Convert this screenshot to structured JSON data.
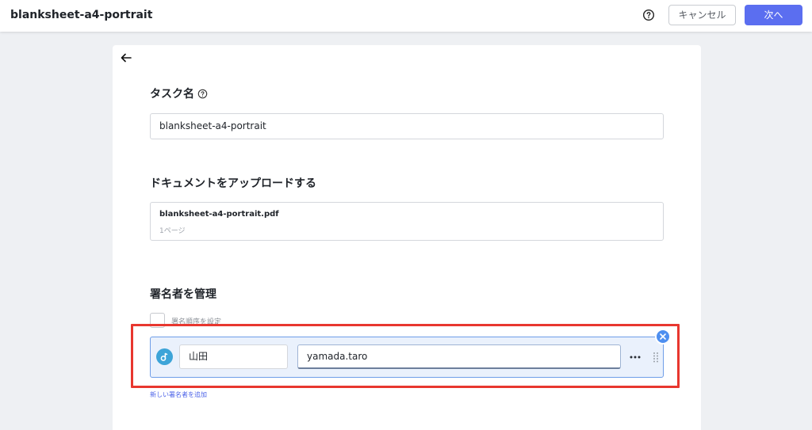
{
  "header": {
    "title": "blanksheet-a4-portrait",
    "cancel_label": "キャンセル",
    "next_label": "次へ"
  },
  "task": {
    "section_title": "タスク名",
    "name_value": "blanksheet-a4-portrait"
  },
  "upload": {
    "section_title": "ドキュメントをアップロードする",
    "file_name": "blanksheet-a4-portrait.pdf",
    "page_count": "1ページ"
  },
  "signers": {
    "section_title": "署名者を管理",
    "order_checkbox_label": "署名順序を設定",
    "order_checked": false,
    "items": [
      {
        "name": "山田",
        "email": "yamada.taro"
      }
    ],
    "add_label": "新しい署名者を追加"
  },
  "colors": {
    "primary": "#5b6ef0",
    "highlight": "#e8372f",
    "signer_row_bg": "#eaf1fc",
    "avatar": "#3da4d8"
  },
  "icons": [
    "help-icon",
    "back-arrow-icon",
    "more-icon",
    "drag-handle-icon",
    "close-icon",
    "signer-avatar-icon"
  ]
}
